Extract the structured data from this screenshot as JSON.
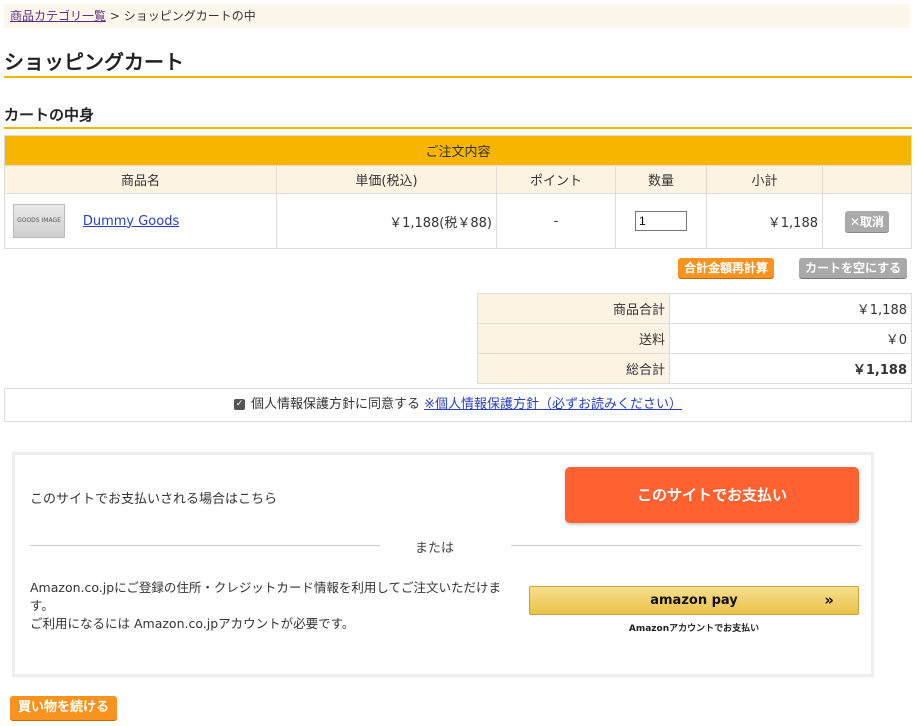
{
  "breadcrumb": {
    "link": "商品カテゴリ一覧",
    "separator": " > ",
    "current": "ショッピングカートの中"
  },
  "page_title": "ショッピングカート",
  "section_title": "カートの中身",
  "cart": {
    "caption": "ご注文内容",
    "headers": [
      "商品名",
      "単価(税込)",
      "ポイント",
      "数量",
      "小計",
      ""
    ],
    "items": [
      {
        "thumb_text": "GOODS IMAGE",
        "name": "Dummy Goods",
        "price": "￥1,188(税￥88)",
        "points": "-",
        "quantity": "1",
        "subtotal": "￥1,188",
        "cancel": "✕取消"
      }
    ]
  },
  "actions": {
    "recalc": "合計金額再計算",
    "empty": "カートを空にする"
  },
  "totals": [
    {
      "label": "商品合計",
      "value": "￥1,188"
    },
    {
      "label": "送料",
      "value": "￥0"
    },
    {
      "label": "総合計",
      "value": "￥1,188"
    }
  ],
  "privacy": {
    "text": "個人情報保護方針に同意する ",
    "link": "※個人情報保護方針（必ずお読みください）"
  },
  "payment": {
    "site_text": "このサイトでお支払いされる場合はこちら",
    "site_button": "このサイトでお支払い",
    "or": "または",
    "amazon_line1": "Amazon.co.jpにご登録の住所・クレジットカード情報を利用してご注文いただけます。",
    "amazon_line2": "ご利用になるには Amazon.co.jpアカウントが必要です。",
    "amazon_button": "amazon pay",
    "amazon_sub": "Amazonアカウントでお支払い"
  },
  "continue_button": "買い物を続ける"
}
